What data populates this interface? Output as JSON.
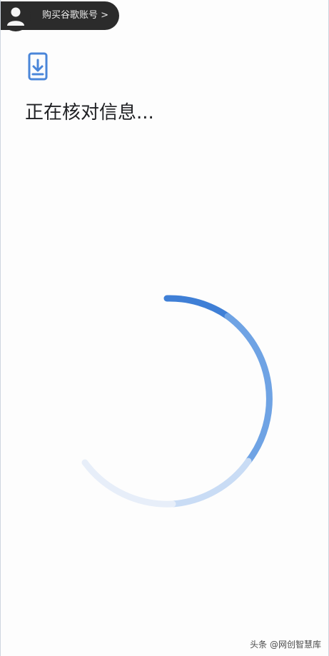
{
  "account": {
    "label": "购买谷歌账号 >",
    "icon": "user-avatar-icon"
  },
  "main": {
    "icon": "phone-download-icon",
    "title": "正在核对信息..."
  },
  "spinner": {
    "icon": "loading-spinner",
    "accent_color": "#4a86d9"
  },
  "watermark": {
    "text": "头条 @网创智慧库"
  }
}
